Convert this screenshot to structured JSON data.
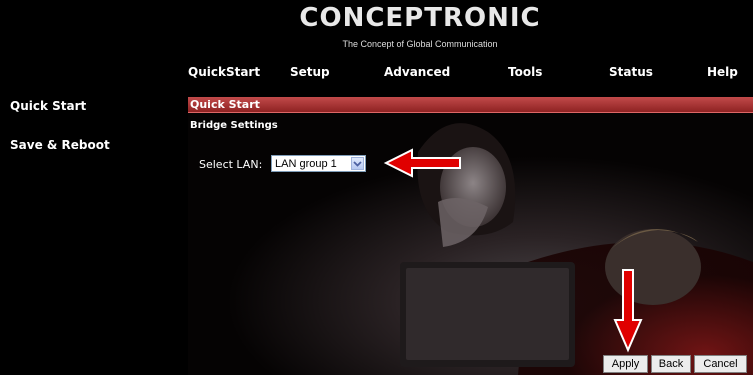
{
  "brand": {
    "name": "CONCEPTRONIC",
    "tagline": "The Concept of Global Communication"
  },
  "nav": {
    "items": [
      {
        "label": "QuickStart"
      },
      {
        "label": "Setup"
      },
      {
        "label": "Advanced"
      },
      {
        "label": "Tools"
      },
      {
        "label": "Status"
      },
      {
        "label": "Help"
      }
    ]
  },
  "sidebar": {
    "items": [
      {
        "label": "Quick Start"
      },
      {
        "label": "Save & Reboot"
      }
    ]
  },
  "main": {
    "title": "Quick Start",
    "section": "Bridge Settings",
    "lan_label": "Select LAN:",
    "lan_value": "LAN group 1"
  },
  "buttons": {
    "apply": "Apply",
    "back": "Back",
    "cancel": "Cancel"
  },
  "colors": {
    "title_bar": "#a83232",
    "annotation_arrow": "#e00000",
    "background": "#000000"
  }
}
